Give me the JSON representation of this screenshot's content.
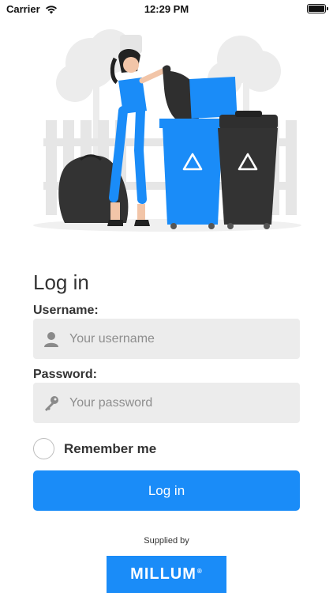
{
  "status_bar": {
    "carrier": "Carrier",
    "time": "12:29 PM"
  },
  "login": {
    "title": "Log in",
    "username_label": "Username:",
    "username_placeholder": "Your username",
    "password_label": "Password:",
    "password_placeholder": "Your password",
    "remember_label": "Remember me",
    "remember_checked": false,
    "button_label": "Log in"
  },
  "footer": {
    "supplied_by": "Supplied by",
    "brand_name": "MILLUM",
    "brand_mark": "®",
    "brand_color": "#1a8cf8"
  },
  "colors": {
    "accent": "#1a8cf8",
    "input_bg": "#ececec",
    "bin_blue": "#1a8cf8",
    "bin_dark": "#2f2f2f"
  },
  "icons": {
    "wifi": "wifi-icon",
    "battery": "battery-icon",
    "user": "user-icon",
    "key": "key-icon",
    "recycle": "recycle-icon"
  }
}
